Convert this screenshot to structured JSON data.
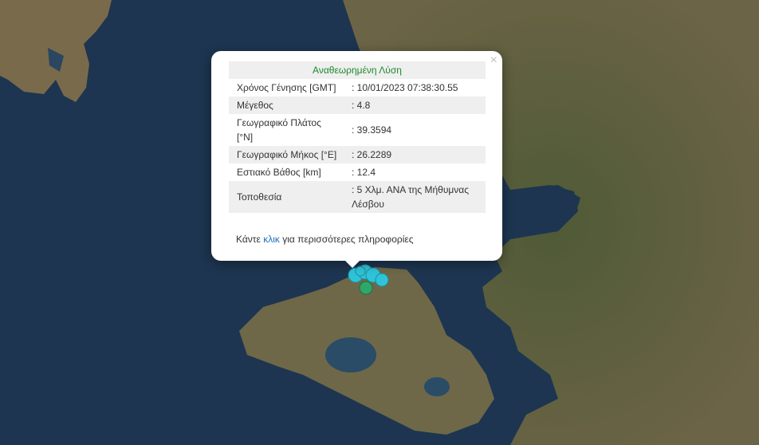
{
  "popup": {
    "header": "Αναθεωρημένη Λύση",
    "close_glyph": "×",
    "rows": [
      {
        "label": "Χρόνος Γένησης [GMT]",
        "value": ": 10/01/2023 07:38:30.55"
      },
      {
        "label": "Μέγεθος",
        "value": ": 4.8"
      },
      {
        "label": "Γεωγραφικό Πλάτος [°N]",
        "value": ": 39.3594"
      },
      {
        "label": "Γεωγραφικό Μήκος [°E]",
        "value": ": 26.2289"
      },
      {
        "label": "Εστιακό Βάθος [km]",
        "value": ": 12.4"
      },
      {
        "label": "Τοποθεσία",
        "value": ": 5 Χλμ. ΑΝΑ της Μήθυμνας Λέσβου"
      }
    ],
    "more_prefix": "Κάντε ",
    "more_link": "κλικ",
    "more_suffix": " για περισσότερες πληροφορίες"
  },
  "colors": {
    "sea": "#1d3550",
    "land": "#5c6340",
    "event_marker": "#2fc3d8",
    "older_marker": "#2ea86a",
    "header_text": "#1c8a2a",
    "link": "#1f6fbf"
  }
}
